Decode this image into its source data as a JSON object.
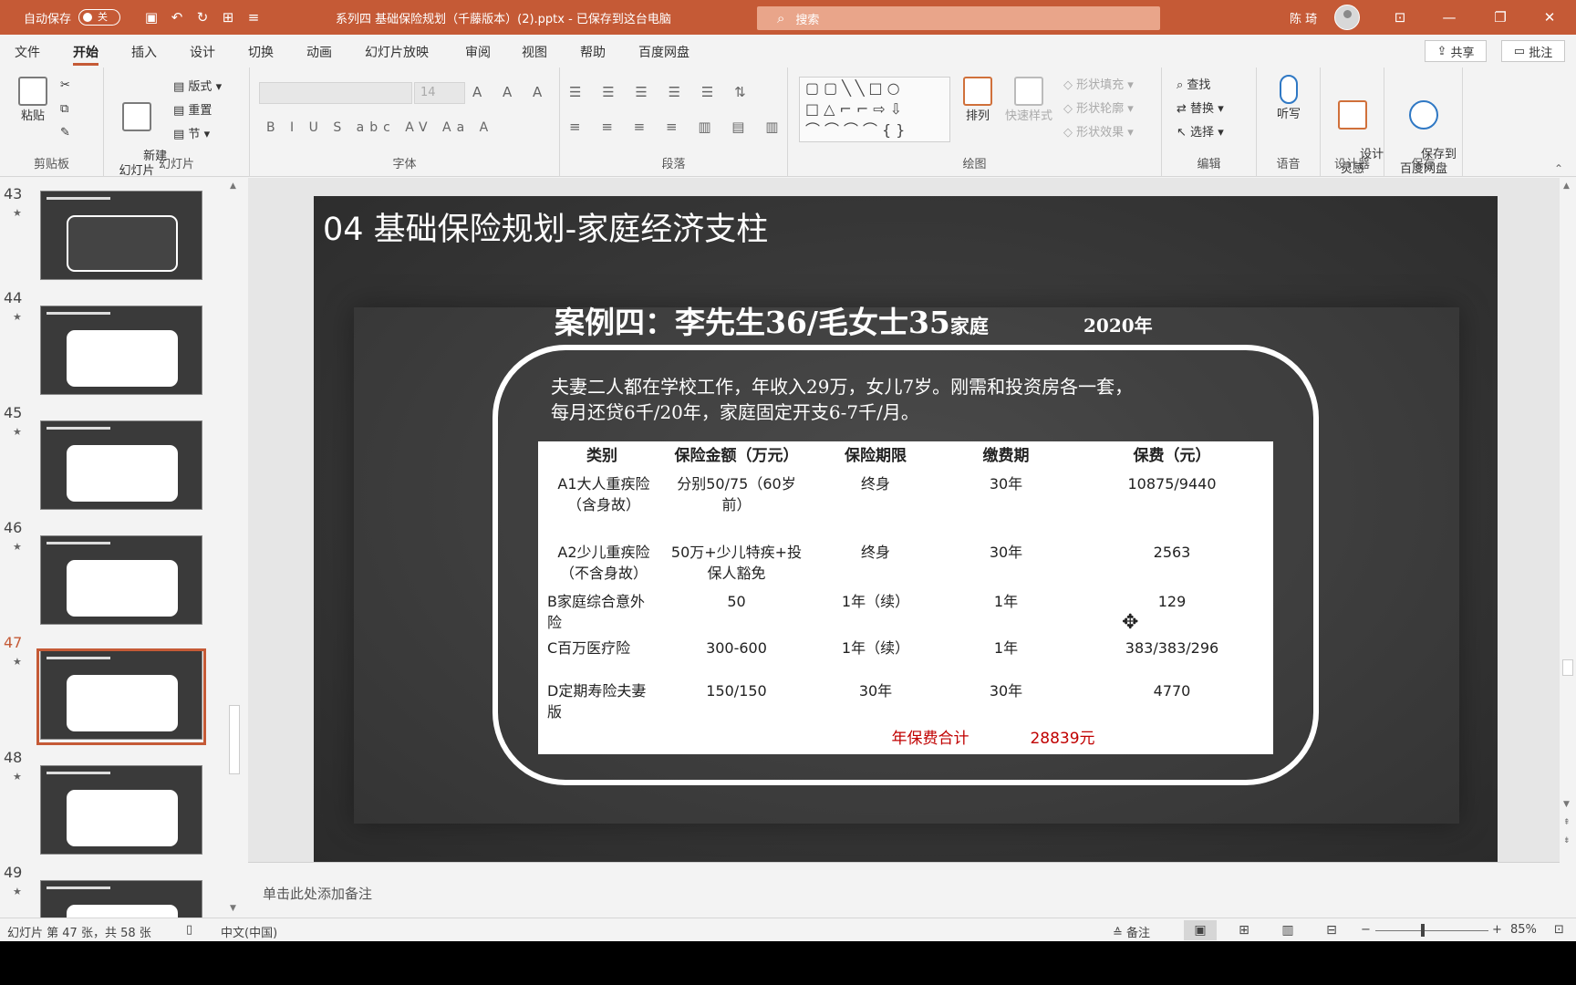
{
  "titlebar": {
    "autosave_label": "自动保存",
    "autosave_state": "关",
    "doc_title": "系列四 基础保险规划（千藤版本）(2).pptx - 已保存到这台电脑",
    "search_placeholder": "搜索",
    "user_name": "陈 琦"
  },
  "menu": {
    "tabs": [
      "文件",
      "开始",
      "插入",
      "设计",
      "切换",
      "动画",
      "幻灯片放映",
      "审阅",
      "视图",
      "帮助",
      "百度网盘"
    ],
    "active_tab": "开始",
    "share_label": "共享",
    "comments_label": "批注"
  },
  "ribbon": {
    "clipboard": {
      "label": "剪贴板",
      "paste": "粘贴"
    },
    "slides": {
      "label": "幻灯片",
      "new_slide": "新建\n幻灯片",
      "layout": "版式",
      "reset": "重置",
      "section": "节"
    },
    "font": {
      "label": "字体",
      "font_size": "14",
      "format_glyphs": "B  I  U  S  abc  AV  Aa  A"
    },
    "paragraph": {
      "label": "段落"
    },
    "drawing": {
      "label": "绘图",
      "arrange": "排列",
      "quick_styles": "快速样式",
      "shape_fill": "形状填充",
      "shape_outline": "形状轮廓",
      "shape_effects": "形状效果"
    },
    "editing": {
      "label": "编辑",
      "find": "查找",
      "replace": "替换",
      "select": "选择"
    },
    "voice": {
      "label": "语音",
      "dictate": "听写"
    },
    "designer": {
      "label": "设计器",
      "design_ideas": "设计\n灵感"
    },
    "save": {
      "label": "保存",
      "save_to_baidu": "保存到\n百度网盘"
    }
  },
  "thumbnails": [
    {
      "num": "43",
      "star": "★"
    },
    {
      "num": "44",
      "star": "★"
    },
    {
      "num": "45",
      "star": "★"
    },
    {
      "num": "46",
      "star": "★"
    },
    {
      "num": "47",
      "star": "★"
    },
    {
      "num": "48",
      "star": "★"
    },
    {
      "num": "49",
      "star": "★"
    }
  ],
  "slide": {
    "title": "04 基础保险规划-家庭经济支柱",
    "case_title": "案例四：李先生36/毛女士35",
    "case_title_suffix": "家庭",
    "year": "2020年",
    "description_line1": "夫妻二人都在学校工作，年收入29万，女儿7岁。刚需和投资房各一套，",
    "description_line2": "每月还贷6千/20年，家庭固定开支6-7千/月。",
    "table": {
      "headers": [
        "类别",
        "保险金额（万元）",
        "保险期限",
        "缴费期",
        "保费（元）"
      ],
      "rows": [
        {
          "cat": "A1大人重疾险\n（含身故）",
          "amount": "分别50/75（60岁\n前）",
          "term": "终身",
          "pay": "30年",
          "premium": "10875/9440"
        },
        {
          "cat": "A2少儿重疾险\n（不含身故）",
          "amount": "50万+少儿特疾+投\n保人豁免",
          "term": "终身",
          "pay": "30年",
          "premium": "2563"
        },
        {
          "cat": "B家庭综合意外\n险",
          "amount": "50",
          "term": "1年（续）",
          "pay": "1年",
          "premium": "129"
        },
        {
          "cat": "C百万医疗险",
          "amount": "300-600",
          "term": "1年（续）",
          "pay": "1年",
          "premium": "383/383/296"
        },
        {
          "cat": "D定期寿险夫妻\n版",
          "amount": "150/150",
          "term": "30年",
          "pay": "30年",
          "premium": "4770"
        }
      ],
      "total_label": "年保费合计",
      "total_value": "28839元"
    }
  },
  "notes_placeholder": "单击此处添加备注",
  "status": {
    "slide_info": "幻灯片 第 47 张，共 58 张",
    "language": "中文(中国)",
    "notes_label": "备注",
    "zoom": "85%"
  },
  "colors": {
    "accent": "#c55a36",
    "slide_bg": "#363636",
    "red_text": "#c00000"
  }
}
